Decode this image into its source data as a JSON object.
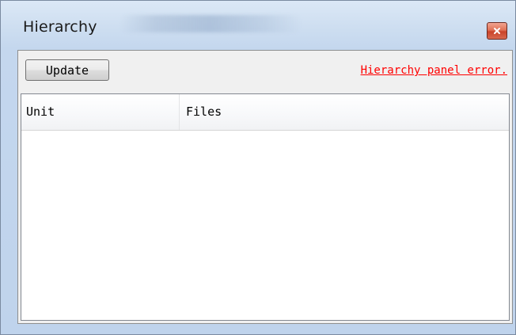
{
  "window": {
    "title": "Hierarchy",
    "close_label": "x"
  },
  "toolbar": {
    "update_label": "Update",
    "error_text": "Hierarchy panel error."
  },
  "list": {
    "columns": [
      "Unit",
      "Files"
    ],
    "rows": []
  },
  "colors": {
    "error": "#ff0000",
    "titlebar": "#cfdff1",
    "close_button": "#c9432a"
  }
}
